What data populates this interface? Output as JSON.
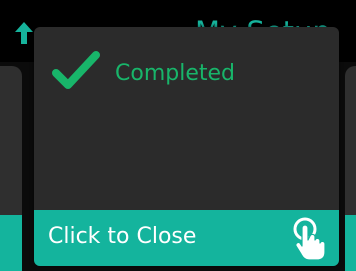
{
  "header": {
    "title": "My Setup",
    "back_icon": "back-arrow-icon",
    "accent_color": "#16b39c"
  },
  "dialog": {
    "status_icon": "checkmark-icon",
    "status_text": "Completed",
    "status_color": "#18b56a",
    "close_label": "Click to Close",
    "close_icon": "tap-hand-icon",
    "close_bar_color": "#14b49d"
  }
}
